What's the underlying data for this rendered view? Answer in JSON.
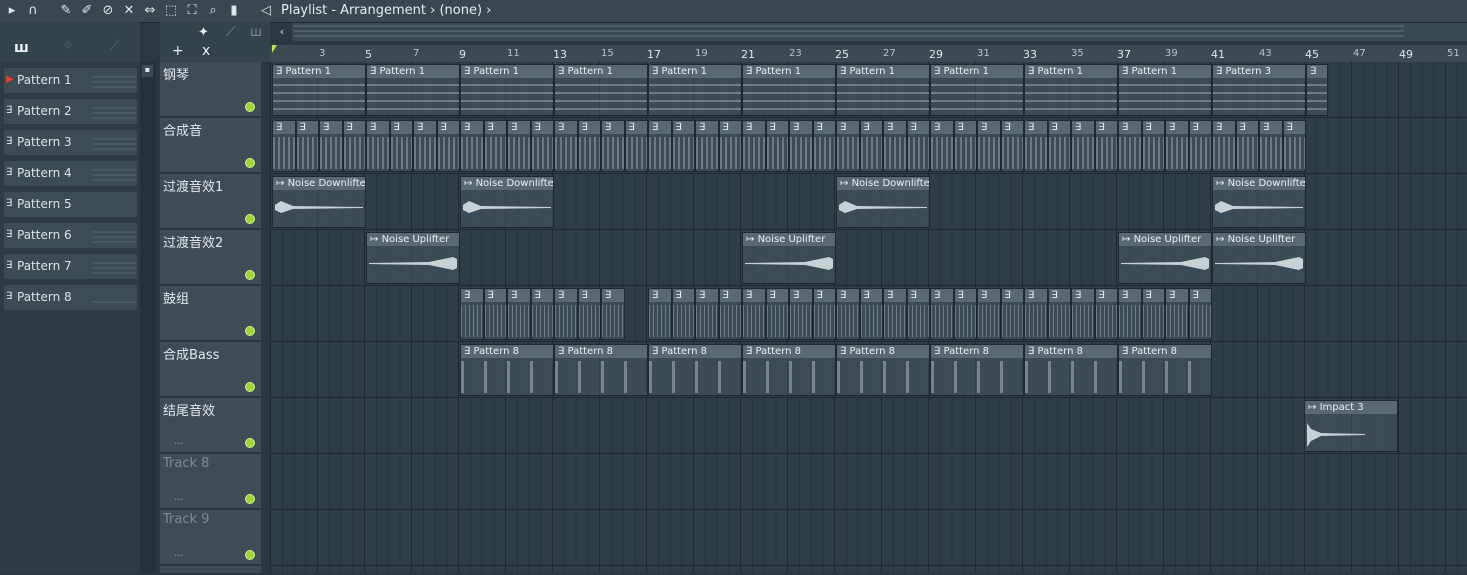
{
  "toolbar": {
    "title": "Playlist - Arrangement",
    "title_sep": "›",
    "pattern_selector": "(none)",
    "icons": [
      "play-arrow-icon",
      "magnet-icon",
      "pencil-icon",
      "brush-icon",
      "delete-icon",
      "mute-icon",
      "slip-icon",
      "select-icon",
      "zoom-icon",
      "playback-icon",
      "speaker-icon"
    ]
  },
  "picker": {
    "patterns": [
      {
        "label": "Pattern 1"
      },
      {
        "label": "Pattern 2"
      },
      {
        "label": "Pattern 3"
      },
      {
        "label": "Pattern 4"
      },
      {
        "label": "Pattern 5"
      },
      {
        "label": "Pattern 6"
      },
      {
        "label": "Pattern 7"
      },
      {
        "label": "Pattern 8"
      }
    ]
  },
  "tracks": [
    {
      "name": "钢琴"
    },
    {
      "name": "合成音"
    },
    {
      "name": "过渡音效1"
    },
    {
      "name": "过渡音效2"
    },
    {
      "name": "鼓组"
    },
    {
      "name": "合成Bass"
    },
    {
      "name": "结尾音效"
    },
    {
      "name": "Track 8"
    },
    {
      "name": "Track 9"
    }
  ],
  "track_dots": "...",
  "header_tools": {
    "add": "+",
    "close": "x"
  },
  "ruler": {
    "bars_major": [
      "5",
      "9",
      "13",
      "17",
      "21",
      "25",
      "29",
      "33",
      "37",
      "41",
      "45",
      "49"
    ],
    "bars_minor": [
      "3",
      "7",
      "11",
      "15",
      "19",
      "23",
      "27",
      "31",
      "35",
      "39",
      "43",
      "47",
      "51"
    ]
  },
  "clips": {
    "row0": [
      {
        "label": "Pattern 1"
      },
      {
        "label": "Pattern 1"
      },
      {
        "label": "Pattern 1"
      },
      {
        "label": "Pattern 1"
      },
      {
        "label": "Pattern 1"
      },
      {
        "label": "Pattern 1"
      },
      {
        "label": "Pattern 1"
      },
      {
        "label": "Pattern 1"
      },
      {
        "label": "Pattern 1"
      },
      {
        "label": "Pattern 1"
      },
      {
        "label": "Pattern 3"
      }
    ],
    "row2": [
      {
        "label": "Noise Downlifter"
      },
      {
        "label": "Noise Downlifter"
      },
      {
        "label": "Noise Downlifter"
      },
      {
        "label": "Noise Downlifter"
      }
    ],
    "row3": [
      {
        "label": "Noise Uplifter"
      },
      {
        "label": "Noise Uplifter"
      },
      {
        "label": "Noise Uplifter"
      },
      {
        "label": "Noise Uplifter"
      }
    ],
    "row5": [
      {
        "label": "Pattern 8"
      },
      {
        "label": "Pattern 8"
      },
      {
        "label": "Pattern 8"
      },
      {
        "label": "Pattern 8"
      },
      {
        "label": "Pattern 8"
      },
      {
        "label": "Pattern 8"
      },
      {
        "label": "Pattern 8"
      },
      {
        "label": "Pattern 8"
      }
    ],
    "row6": [
      {
        "label": "Impact 3"
      }
    ]
  },
  "colors": {
    "accent_led": "#9fd43c",
    "background": "#2f3d45",
    "clip_header": "#596871"
  }
}
